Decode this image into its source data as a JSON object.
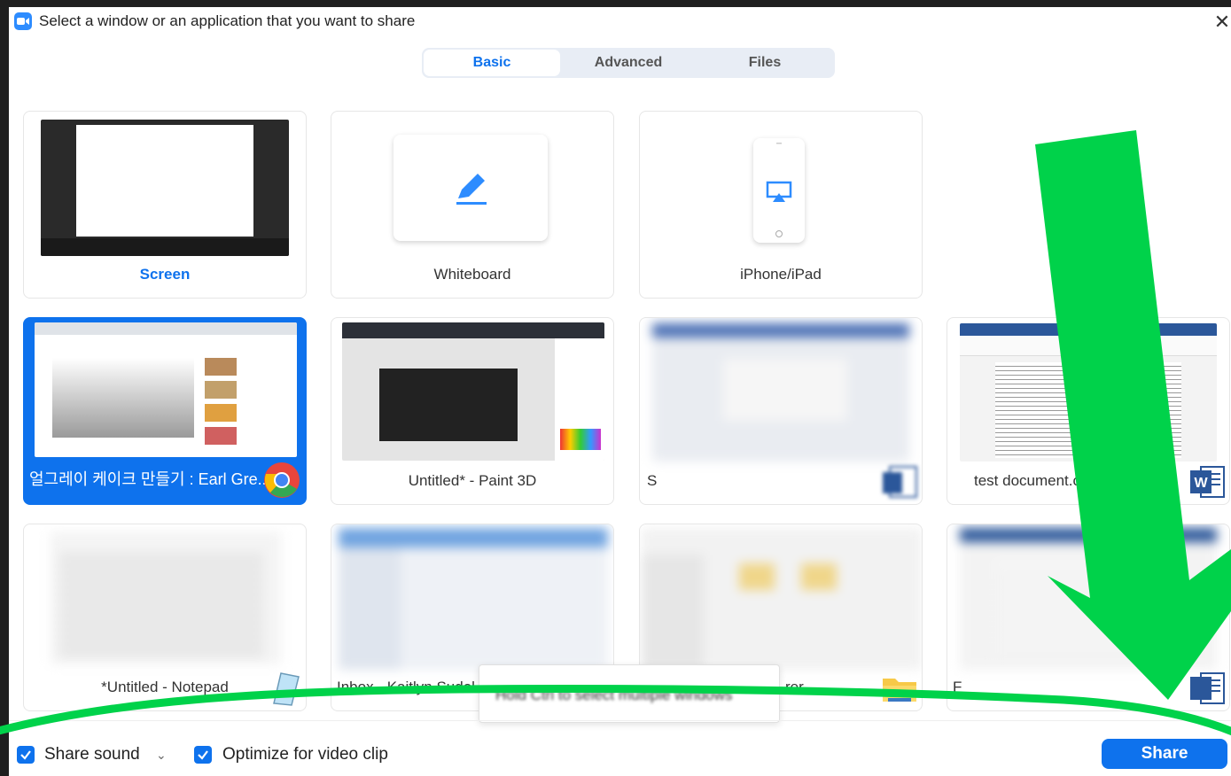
{
  "window": {
    "title": "Select a window or an application that you want to share",
    "close_label": "✕"
  },
  "tabs": [
    {
      "label": "Basic",
      "active": true
    },
    {
      "label": "Advanced",
      "active": false
    },
    {
      "label": "Files",
      "active": false
    }
  ],
  "tiles": {
    "screen": "Screen",
    "whiteboard": "Whiteboard",
    "iphone": "iPhone/iPad",
    "chrome": "얼그레이 케이크 만들기 : Earl Gre...",
    "paint3d": "Untitled* - Paint 3D",
    "blurred_window": "S",
    "word_doc": "test document.c",
    "notepad": "*Untitled - Notepad",
    "outlook": "Inbox - Kaitlyn Sudol",
    "explorer": "rer",
    "word_doc2": "F"
  },
  "tooltip": {
    "text": "Hold Ctrl to select multiple windows"
  },
  "footer": {
    "share_sound": "Share sound",
    "optimize_video": "Optimize for video clip",
    "share_button": "Share"
  },
  "colors": {
    "accent": "#0e72ed",
    "annotation_arrow": "#00d24a"
  }
}
